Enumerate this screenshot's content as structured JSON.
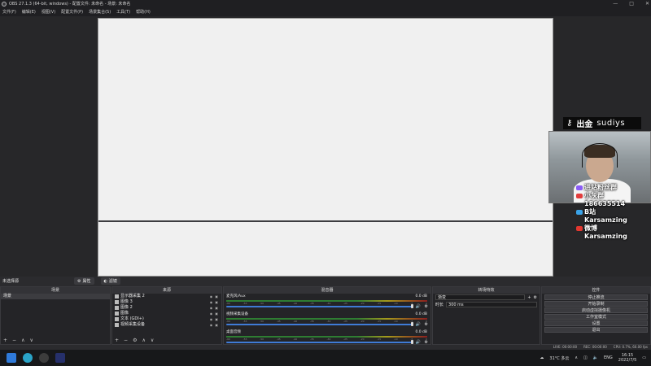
{
  "window": {
    "title": "OBS 27.1.3 (64-bit, windows) - 配置文件: 未命名 - 场景: 未命名",
    "controls": [
      "—",
      "□",
      "✕"
    ]
  },
  "menu": [
    "文件(F)",
    "编辑(E)",
    "视图(V)",
    "配置文件(P)",
    "场景集合(S)",
    "工具(T)",
    "帮助(H)"
  ],
  "overlay": {
    "badge_text": "出金",
    "badge_name": "sudiys",
    "social": [
      {
        "icon": "group-icon",
        "color": "#8a5cf5",
        "text": "进站粉丝群"
      },
      {
        "icon": "qq-icon",
        "color": "#e23c3c",
        "text": "小灰群"
      },
      {
        "icon": "number-icon",
        "color": "#c9a700",
        "text": "186635514"
      },
      {
        "icon": "bilibili-icon",
        "color": "#3aa3e8",
        "text": "B站"
      },
      {
        "icon": "name-icon",
        "color": "#3aa3e8",
        "text": "Karsamzing"
      },
      {
        "icon": "weibo-icon",
        "color": "#e2372f",
        "text": "微博"
      },
      {
        "icon": "name2-icon",
        "color": "#e2372f",
        "text": "Karsamzing"
      }
    ]
  },
  "scene_bar": {
    "label": "未选择源",
    "props": "属性",
    "filters": "滤镜"
  },
  "scenes": {
    "title": "场景",
    "items": [
      "场景"
    ],
    "footer": [
      "+",
      "−",
      "∧",
      "∨"
    ]
  },
  "sources": {
    "title": "来源",
    "items": [
      "显示器采集 2",
      "图像 3",
      "图像 2",
      "图像",
      "文本 (GDI+)",
      "视频采集设备"
    ],
    "footer": [
      "+",
      "−",
      "⚙",
      "∧",
      "∨"
    ]
  },
  "mixer": {
    "title": "混音器",
    "channels": [
      {
        "name": "麦克风/Aux",
        "db": "0.0 dB",
        "level": 1.0
      },
      {
        "name": "视频采集设备",
        "db": "0.0 dB",
        "level": 1.0
      },
      {
        "name": "桌面音频",
        "db": "0.0 dB",
        "level": 1.0
      }
    ],
    "ticks": [
      "-60",
      "-55",
      "-50",
      "-45",
      "-40",
      "-35",
      "-30",
      "-25",
      "-20",
      "-15",
      "-10",
      "-5",
      "0"
    ]
  },
  "transitions": {
    "title": "转场特效",
    "type": "渐变",
    "duration_label": "时长",
    "duration": "300 ms"
  },
  "controls": {
    "title": "控件",
    "buttons": [
      "停止推流",
      "开始录制",
      "启动虚拟摄像机",
      "工作室模式",
      "设置",
      "退出"
    ]
  },
  "status": {
    "live": "LIVE: 00:00:00",
    "rec": "REC: 00:00:00",
    "cpu": "CPU: 0.7%, 60.00 fps"
  },
  "taskbar": {
    "weather": "31°C 多云",
    "lang": "ENG",
    "time": "16:15",
    "date": "2022/7/5"
  }
}
